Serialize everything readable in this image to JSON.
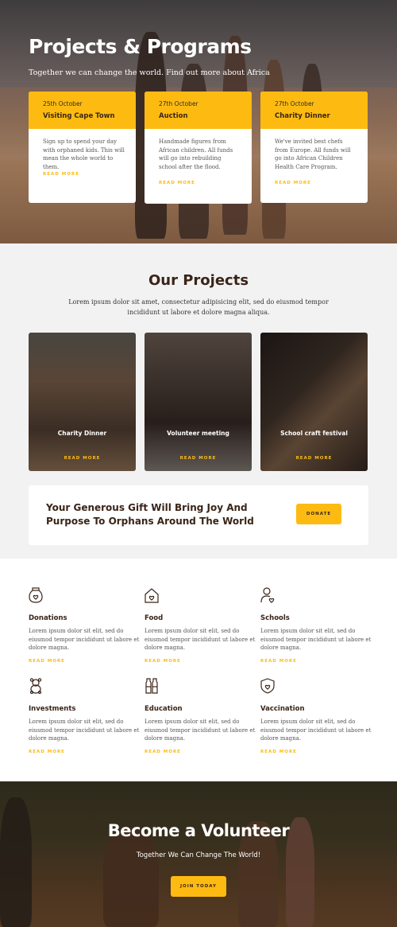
{
  "hero": {
    "title": "Projects & Programs",
    "subtitle": "Together we can change the world. Find out more about Africa",
    "cards": [
      {
        "date": "25th October",
        "title": "Visiting Cape Town",
        "text": "Sign up to spend your day with orphaned kids. This will mean the whole world to them.",
        "link": "READ MORE"
      },
      {
        "date": "27th October",
        "title": "Auction",
        "text": "Handmade figures from African children. All funds will go into rebuilding school after the flood.",
        "link": "READ MORE"
      },
      {
        "date": "27th October",
        "title": "Charity Dinner",
        "text": "We've invited best chefs from Europe. All funds will go into African Children Health Care Program.",
        "link": "READ MORE"
      }
    ]
  },
  "projects": {
    "title": "Our Projects",
    "lead": "Lorem ipsum dolor sit amet, consectetur adipisicing elit, sed do eiusmod tempor incididunt ut labore et dolore magna aliqua.",
    "items": [
      {
        "title": "Charity Dinner",
        "link": "READ MORE"
      },
      {
        "title": "Volunteer meeting",
        "link": "READ MORE"
      },
      {
        "title": "School craft festival",
        "link": "READ MORE"
      }
    ]
  },
  "gift": {
    "text": "Your Generous Gift Will Bring Joy And Purpose To Orphans Around The World",
    "button": "DONATE"
  },
  "features": [
    {
      "icon": "donation-jar-icon",
      "title": "Donations",
      "text": "Lorem ipsum dolor sit elit, sed do eiusmod tempor incididunt ut labore et dolore magna.",
      "link": "READ MORE"
    },
    {
      "icon": "house-heart-icon",
      "title": "Food",
      "text": "Lorem ipsum dolor sit elit, sed do eiusmod tempor incididunt ut labore et dolore magna.",
      "link": "READ MORE"
    },
    {
      "icon": "person-heart-icon",
      "title": "Schools",
      "text": "Lorem ipsum dolor sit elit, sed do eiusmod tempor incididunt ut labore et dolore magna.",
      "link": "READ MORE"
    },
    {
      "icon": "teddy-bear-icon",
      "title": "Investments",
      "text": "Lorem ipsum dolor sit elit, sed do eiusmod tempor incididunt ut labore et dolore magna.",
      "link": "READ MORE"
    },
    {
      "icon": "bottles-icon",
      "title": "Education",
      "text": "Lorem ipsum dolor sit elit, sed do eiusmod tempor incididunt ut labore et dolore magna.",
      "link": "READ MORE"
    },
    {
      "icon": "shield-heart-icon",
      "title": "Vaccination",
      "text": "Lorem ipsum dolor sit elit, sed do eiusmod tempor incididunt ut labore et dolore magna.",
      "link": "READ MORE"
    }
  ],
  "volunteer": {
    "title": "Become a Volunteer",
    "subtitle": "Together We Can Change The World!",
    "button": "JOIN TODAY"
  },
  "colors": {
    "accent": "#fdbb12",
    "heading": "#3a2418",
    "background": "#f3f2f2"
  }
}
